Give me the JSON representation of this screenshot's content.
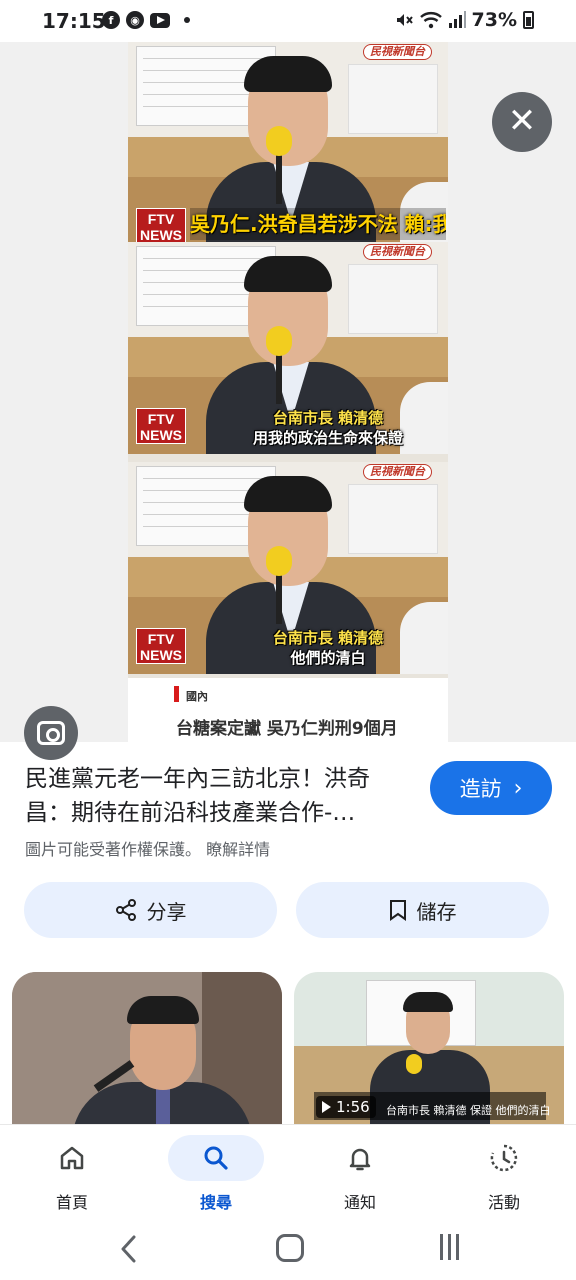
{
  "status_bar": {
    "time": "17:15",
    "battery": "73%",
    "left_icons": [
      "facebook-icon",
      "camera-app-icon",
      "youtube-icon"
    ],
    "right_icons": [
      "mute-icon",
      "wifi-icon",
      "signal-icon",
      "battery-icon"
    ]
  },
  "image": {
    "channel_logo": "民視新聞台",
    "ftv_logo": "FTV NEWS",
    "frame1_caption": "吳乃仁.洪奇昌若涉不法 賴:我退政壇",
    "frame2_caption_line1": "台南市長 賴清德",
    "frame2_caption_line2": "用我的政治生命來保證",
    "frame3_caption_line1": "台南市長 賴清德",
    "frame3_caption_line2": "他們的清白",
    "news_category": "國內",
    "news_headline": "台糖案定讞 吳乃仁判刑9個月"
  },
  "result": {
    "title": "民進黨元老一年內三訪北京！洪奇昌：期待在前沿科技產業合作-…",
    "visit_label": "造訪",
    "copyright_text": "圖片可能受著作權保護。",
    "learn_more": "瞭解詳情",
    "share_label": "分享",
    "save_label": "儲存"
  },
  "related": {
    "video_duration": "1:56",
    "video_caption": "台南市長 賴清德 保證 他們的清白"
  },
  "bottom_nav": {
    "items": [
      {
        "label": "首頁",
        "icon": "home-icon"
      },
      {
        "label": "搜尋",
        "icon": "search-icon",
        "active": true
      },
      {
        "label": "通知",
        "icon": "bell-icon"
      },
      {
        "label": "活動",
        "icon": "activity-icon"
      }
    ]
  },
  "colors": {
    "accent": "#1a73e8",
    "pill_bg": "#e8f0fe",
    "active_nav": "#0b57d0",
    "ftv_red": "#b71c1c",
    "caption_yellow": "#ffd200"
  }
}
